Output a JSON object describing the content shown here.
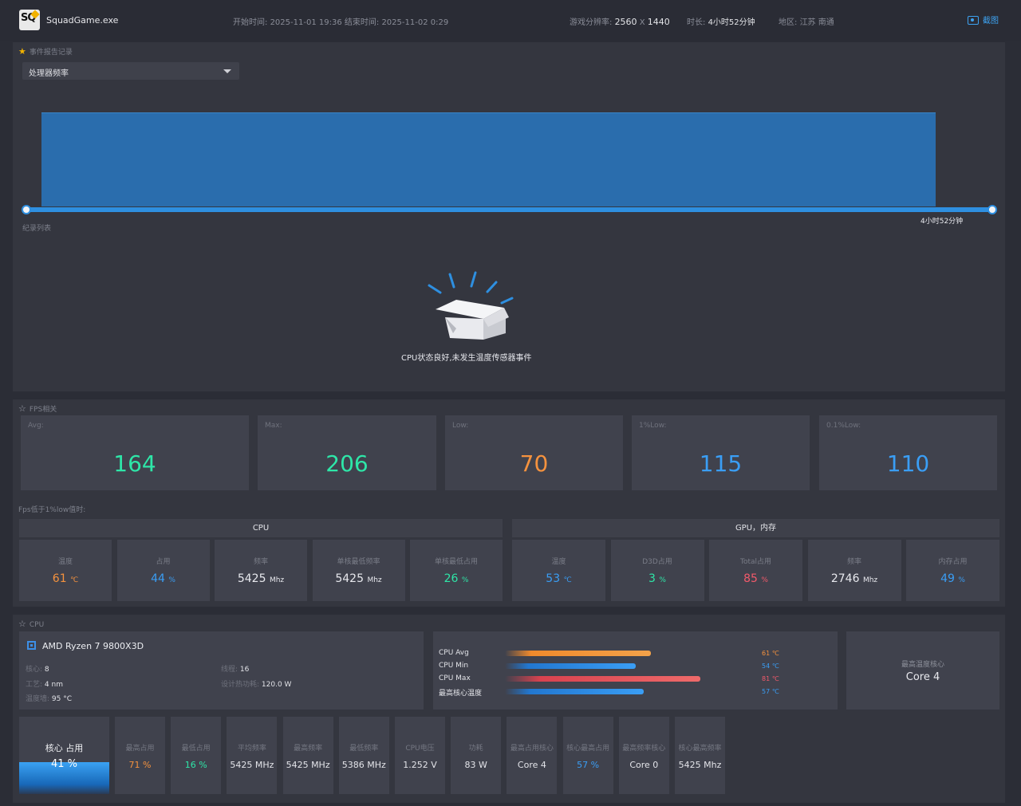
{
  "header": {
    "logo_text": "SQ",
    "app_name": "SquadGame.exe",
    "start_label": "开始时间:",
    "start_time": "2025-11-01 19:36",
    "end_label": "结束时间:",
    "end_time": "2025-11-02 0:29",
    "resolution_label": "游戏分辨率:",
    "resolution_w": "2560",
    "resolution_x": "X",
    "resolution_h": "1440",
    "duration_label": "时长:",
    "duration": "4小时52分钟",
    "region_label": "地区:",
    "region": "江苏 南通",
    "screenshot_label": "截图"
  },
  "events": {
    "title": "事件报告记录",
    "selected_metric": "处理器频率",
    "timeline_end": "4小时52分钟",
    "record_list_label": "纪录列表",
    "empty_message": "CPU状态良好,未发生温度传感器事件"
  },
  "fps": {
    "title": "FPS相关",
    "cards": [
      {
        "label": "Avg:",
        "value": "164",
        "color": "#2ee6a8"
      },
      {
        "label": "Max:",
        "value": "206",
        "color": "#2ee6a8"
      },
      {
        "label": "Low:",
        "value": "70",
        "color": "#f5923e"
      },
      {
        "label": "1%Low:",
        "value": "115",
        "color": "#3a9ef5"
      },
      {
        "label": "0.1%Low:",
        "value": "110",
        "color": "#3a9ef5"
      }
    ],
    "below_1pct_label": "Fps低于1%low值时:"
  },
  "groups": {
    "cpu_title": "CPU",
    "gpu_title": "GPU，内存",
    "cpu": [
      {
        "label": "温度",
        "value": "61",
        "unit": "℃",
        "color": "#f5923e"
      },
      {
        "label": "占用",
        "value": "44",
        "unit": "%",
        "color": "#3a9ef5"
      },
      {
        "label": "频率",
        "value": "5425",
        "unit": "Mhz",
        "color": "#e8e9ee"
      },
      {
        "label": "单核最低频率",
        "value": "5425",
        "unit": "Mhz",
        "color": "#e8e9ee"
      },
      {
        "label": "单核最低占用",
        "value": "26",
        "unit": "%",
        "color": "#2ee6a8"
      }
    ],
    "gpu": [
      {
        "label": "温度",
        "value": "53",
        "unit": "℃",
        "color": "#3a9ef5"
      },
      {
        "label": "D3D占用",
        "value": "3",
        "unit": "%",
        "color": "#2ee6a8"
      },
      {
        "label": "Total占用",
        "value": "85",
        "unit": "%",
        "color": "#f25a6b"
      },
      {
        "label": "频率",
        "value": "2746",
        "unit": "Mhz",
        "color": "#e8e9ee"
      },
      {
        "label": "内存占用",
        "value": "49",
        "unit": "%",
        "color": "#3a9ef5"
      }
    ]
  },
  "cpu": {
    "title": "CPU",
    "name": "AMD Ryzen 7 9800X3D",
    "cores_label": "核心:",
    "cores": "8",
    "threads_label": "线程:",
    "threads": "16",
    "process_label": "工艺:",
    "process": "4 nm",
    "tdp_label": "设计热功耗:",
    "tdp": "120.0 W",
    "tjmax_label": "温度墙:",
    "tjmax": "95 °C",
    "bars": [
      {
        "label": "CPU Avg",
        "value": "61 ℃",
        "fraction": 0.59,
        "color_a": "#f08a2c",
        "color_b": "#f3a24a",
        "text_color": "#f5923e"
      },
      {
        "label": "CPU Min",
        "value": "54 ℃",
        "fraction": 0.53,
        "color_a": "#2277d0",
        "color_b": "#3a9ef5",
        "text_color": "#3a9ef5"
      },
      {
        "label": "CPU Max",
        "value": "81 ℃",
        "fraction": 0.79,
        "color_a": "#d8424f",
        "color_b": "#ef6a6a",
        "text_color": "#f25a6b"
      },
      {
        "label": "最高核心温度",
        "value": "57 ℃",
        "fraction": 0.56,
        "color_a": "#2277d0",
        "color_b": "#3a9ef5",
        "text_color": "#3a9ef5"
      }
    ],
    "hottest_core_label": "最高温度核心",
    "hottest_core": "Core 4",
    "core_usage_label": "核心 占用",
    "core_usage": "41 %",
    "core_usage_fraction": 0.41,
    "cards": [
      {
        "label": "最高占用",
        "value": "71 %",
        "color": "#f5923e"
      },
      {
        "label": "最低占用",
        "value": "16 %",
        "color": "#2ee6a8"
      },
      {
        "label": "平均频率",
        "value": "5425 MHz",
        "color": "#e3e4e9"
      },
      {
        "label": "最高频率",
        "value": "5425 MHz",
        "color": "#e3e4e9"
      },
      {
        "label": "最低频率",
        "value": "5386 MHz",
        "color": "#e3e4e9"
      },
      {
        "label": "CPU电压",
        "value": "1.252 V",
        "color": "#e3e4e9"
      },
      {
        "label": "功耗",
        "value": "83 W",
        "color": "#e3e4e9"
      },
      {
        "label": "最高占用核心",
        "value": "Core 4",
        "color": "#e3e4e9"
      },
      {
        "label": "核心最高占用",
        "value": "57 %",
        "color": "#3a9ef5"
      },
      {
        "label": "最高频率核心",
        "value": "Core 0",
        "color": "#e3e4e9"
      },
      {
        "label": "核心最高频率",
        "value": "5425 Mhz",
        "color": "#e3e4e9"
      }
    ]
  }
}
